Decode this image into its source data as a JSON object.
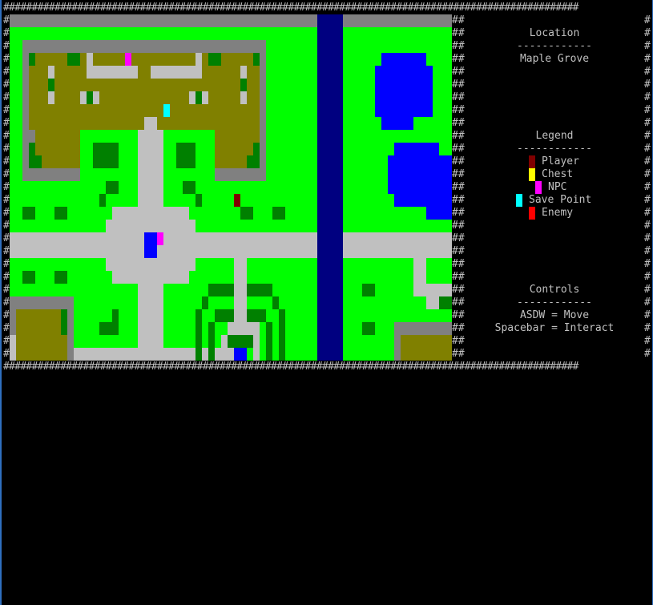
{
  "border": {
    "char": "#"
  },
  "panel": {
    "location_title": "Location",
    "location_rule": "------------",
    "location_name": "Maple Grove",
    "legend_title": "Legend",
    "legend_rule": "------------",
    "legend": [
      {
        "label": "Player",
        "color": "#800000"
      },
      {
        "label": "Chest",
        "color": "#ffff00"
      },
      {
        "label": "NPC",
        "color": "#ff00ff"
      },
      {
        "label": "Save Point",
        "color": "#00ffff"
      },
      {
        "label": "Enemy",
        "color": "#ff0000"
      }
    ],
    "controls_title": "Controls",
    "controls_rule": "------------",
    "controls": [
      "ASDW = Move",
      "Spacebar = Interact"
    ]
  },
  "map": {
    "colors": {
      "grass": "#00ff00",
      "tree": "#008000",
      "path": "#c0c0c0",
      "wall": "#808080",
      "floor": "#808000",
      "river": "#000080",
      "pond": "#0000ff",
      "player": "#800000",
      "npc": "#ff00ff",
      "save_point": "#00ffff",
      "door": "#0000ff"
    }
  }
}
